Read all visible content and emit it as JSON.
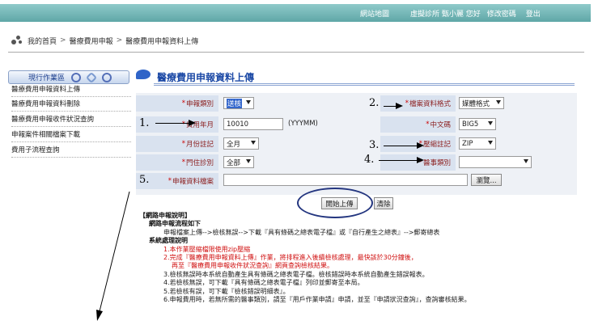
{
  "topbar": {
    "sitemap": "網站地圖",
    "welcome": "虛擬診所 甄小麗 您好",
    "change_password": "修改密碼",
    "logout": "登出"
  },
  "breadcrumb": [
    "我的首頁",
    "醫療費用申報",
    "醫療費用申報資料上傳"
  ],
  "sidebar": {
    "header": "現行作業區",
    "items": [
      "醫療費用申報資料上傳",
      "醫療費用申報資料刪除",
      "醫療費用申報收件狀況查詢",
      "申報案件相關檔案下載",
      "費用子流程查詢"
    ]
  },
  "page_title": "醫療費用申報資料上傳",
  "form": {
    "declare_type": {
      "label": "申報類別",
      "value": "送核"
    },
    "file_format": {
      "label": "檔案資料格式",
      "value": "媒體格式"
    },
    "fee_month": {
      "label": "費用年月",
      "value": "10010",
      "unit": "(YYYMM)"
    },
    "chinese_code": {
      "label": "中文碼",
      "value": "BIG5"
    },
    "month_note": {
      "label": "月份註記",
      "value": "全月"
    },
    "compress_note": {
      "label": "壓縮註記",
      "value": "ZIP"
    },
    "clinic_type": {
      "label": "門住診別",
      "value": "全部"
    },
    "medical_category": {
      "label": "醫事類別",
      "value": ""
    },
    "data_file": {
      "label": "申報資料檔案",
      "browse": "瀏覽..."
    }
  },
  "annotations": [
    "1.",
    "2.",
    "3.",
    "4.",
    "5."
  ],
  "buttons": {
    "upload": "開始上傳",
    "clear": "清除"
  },
  "notes": {
    "title": "【網路申報說明】",
    "flow_title": "網路申報流程如下",
    "flow": "申報檔案上傳-->檢核無誤-->下載『具有條碼之總表電子檔』或『自行產生之總表』-->郵寄總表",
    "system_title": "系統處理說明",
    "items": [
      "1.本作業壓縮檔限使用zip壓縮",
      "2.完成『醫療費用申報資料上傳』作業，將排程進入後續檢核處理，最快該於30分鐘後，",
      "再至『醫療費用申報收件狀況查詢』網頁查詢檢核結果。",
      "3.檢核無誤時本系統自動產生具有條碼之總表電子檔。檢核錯誤時本系統自動產生錯誤報表。",
      "4.若檢核無誤，可下載『具有條碼之總表電子檔』列印並郵寄至本局。",
      "5.若檢核有誤，可下載『檢核錯誤明細表』。",
      "6.申報費用時，若無所需的醫事類別，請至『用戶作業申請』申請，並至『申請狀況查詢』，查詢審核結果。"
    ]
  }
}
